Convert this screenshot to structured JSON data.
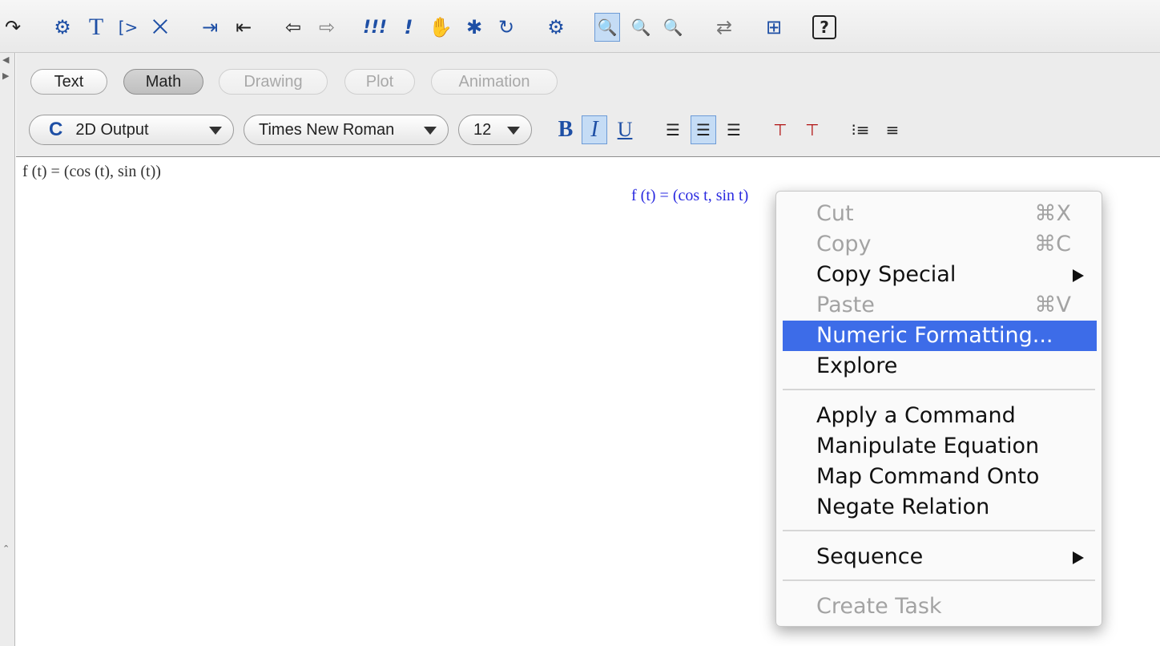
{
  "toolbar": {
    "icons": [
      {
        "name": "redo-icon",
        "glyph": "↷"
      },
      {
        "name": "execute-group-icon",
        "glyph": "⚙"
      },
      {
        "name": "text-mode-icon",
        "glyph": "T"
      },
      {
        "name": "prompt-icon",
        "glyph": "[>"
      },
      {
        "name": "sum-icon",
        "glyph": "⨉"
      },
      {
        "name": "indent-icon",
        "glyph": "⇥"
      },
      {
        "name": "outdent-icon",
        "glyph": "⇤"
      },
      {
        "name": "back-arrow-icon",
        "glyph": "⇦"
      },
      {
        "name": "forward-arrow-icon",
        "glyph": "⇨"
      },
      {
        "name": "execute-all-icon",
        "glyph": "!!!"
      },
      {
        "name": "execute-icon",
        "glyph": "!"
      },
      {
        "name": "stop-hand-icon",
        "glyph": "✋"
      },
      {
        "name": "debug-bug-icon",
        "glyph": "✱"
      },
      {
        "name": "restart-icon",
        "glyph": "↻"
      },
      {
        "name": "settings-gear-icon",
        "glyph": "⚙"
      },
      {
        "name": "zoom-100-icon",
        "glyph": "🔍"
      },
      {
        "name": "zoom-150-icon",
        "glyph": "🔍"
      },
      {
        "name": "zoom-200-icon",
        "glyph": "🔍"
      },
      {
        "name": "swap-icon",
        "glyph": "⇄"
      },
      {
        "name": "math-palette-icon",
        "glyph": "⊞"
      },
      {
        "name": "help-icon",
        "glyph": "?"
      }
    ]
  },
  "modes": {
    "text": "Text",
    "math": "Math",
    "drawing": "Drawing",
    "plot": "Plot",
    "animation": "Animation"
  },
  "format": {
    "style_icon": "C",
    "style": "2D Output",
    "font": "Times New Roman",
    "size": "12",
    "bold": "B",
    "italic": "I",
    "underline": "U"
  },
  "document": {
    "input": "f (t) = (cos (t), sin (t))",
    "output": "f (t) = (cos t, sin t)"
  },
  "context_menu": {
    "cut": {
      "label": "Cut",
      "shortcut": "⌘X"
    },
    "copy": {
      "label": "Copy",
      "shortcut": "⌘C"
    },
    "copy_special": {
      "label": "Copy Special"
    },
    "paste": {
      "label": "Paste",
      "shortcut": "⌘V"
    },
    "numeric_formatting": {
      "label": "Numeric Formatting..."
    },
    "explore": {
      "label": "Explore"
    },
    "apply_command": {
      "label": "Apply a Command"
    },
    "manipulate_equation": {
      "label": "Manipulate Equation"
    },
    "map_command": {
      "label": "Map Command Onto"
    },
    "negate_relation": {
      "label": "Negate Relation"
    },
    "sequence": {
      "label": "Sequence"
    },
    "create_task": {
      "label": "Create Task"
    }
  },
  "colors": {
    "menu_highlight": "#3d6ce8",
    "output_text": "#2a2ae0",
    "icon_blue": "#1e4fa5"
  }
}
